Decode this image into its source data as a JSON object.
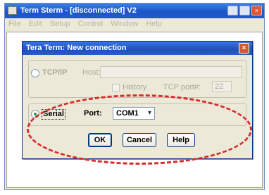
{
  "main_window": {
    "title": "Term Sterm - [disconnected] V2",
    "menu": [
      "File",
      "Edit",
      "Setup",
      "Control",
      "Window",
      "Help"
    ]
  },
  "dialog": {
    "title": "Tera Term: New connection",
    "close_glyph": "×",
    "tcpip": {
      "label": "TCP/IP",
      "host_label": "Host:",
      "host_value": "",
      "history_label": "History",
      "service_label": "TCP port#:",
      "port_value": "22"
    },
    "serial": {
      "label": "Serial",
      "selected": true,
      "port_label": "Port:",
      "port_value": "COM1",
      "dropdown_glyph": "▾"
    },
    "buttons": {
      "ok": "OK",
      "cancel": "Cancel",
      "help": "Help"
    }
  },
  "annotation": {
    "color": "#d92b2b",
    "style": "dashed ellipse"
  }
}
